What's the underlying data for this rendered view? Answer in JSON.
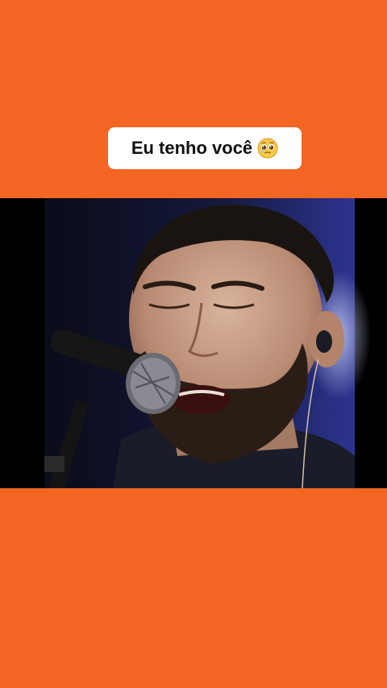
{
  "caption": {
    "text": "Eu tenho você",
    "emoji": "pleading-face-emoji"
  },
  "video": {
    "subject": "singer-with-microphone",
    "icon": "video-frame"
  },
  "colors": {
    "background": "#f26522",
    "caption_bg": "#ffffff",
    "caption_text": "#111111",
    "video_letterbox": "#000000"
  }
}
